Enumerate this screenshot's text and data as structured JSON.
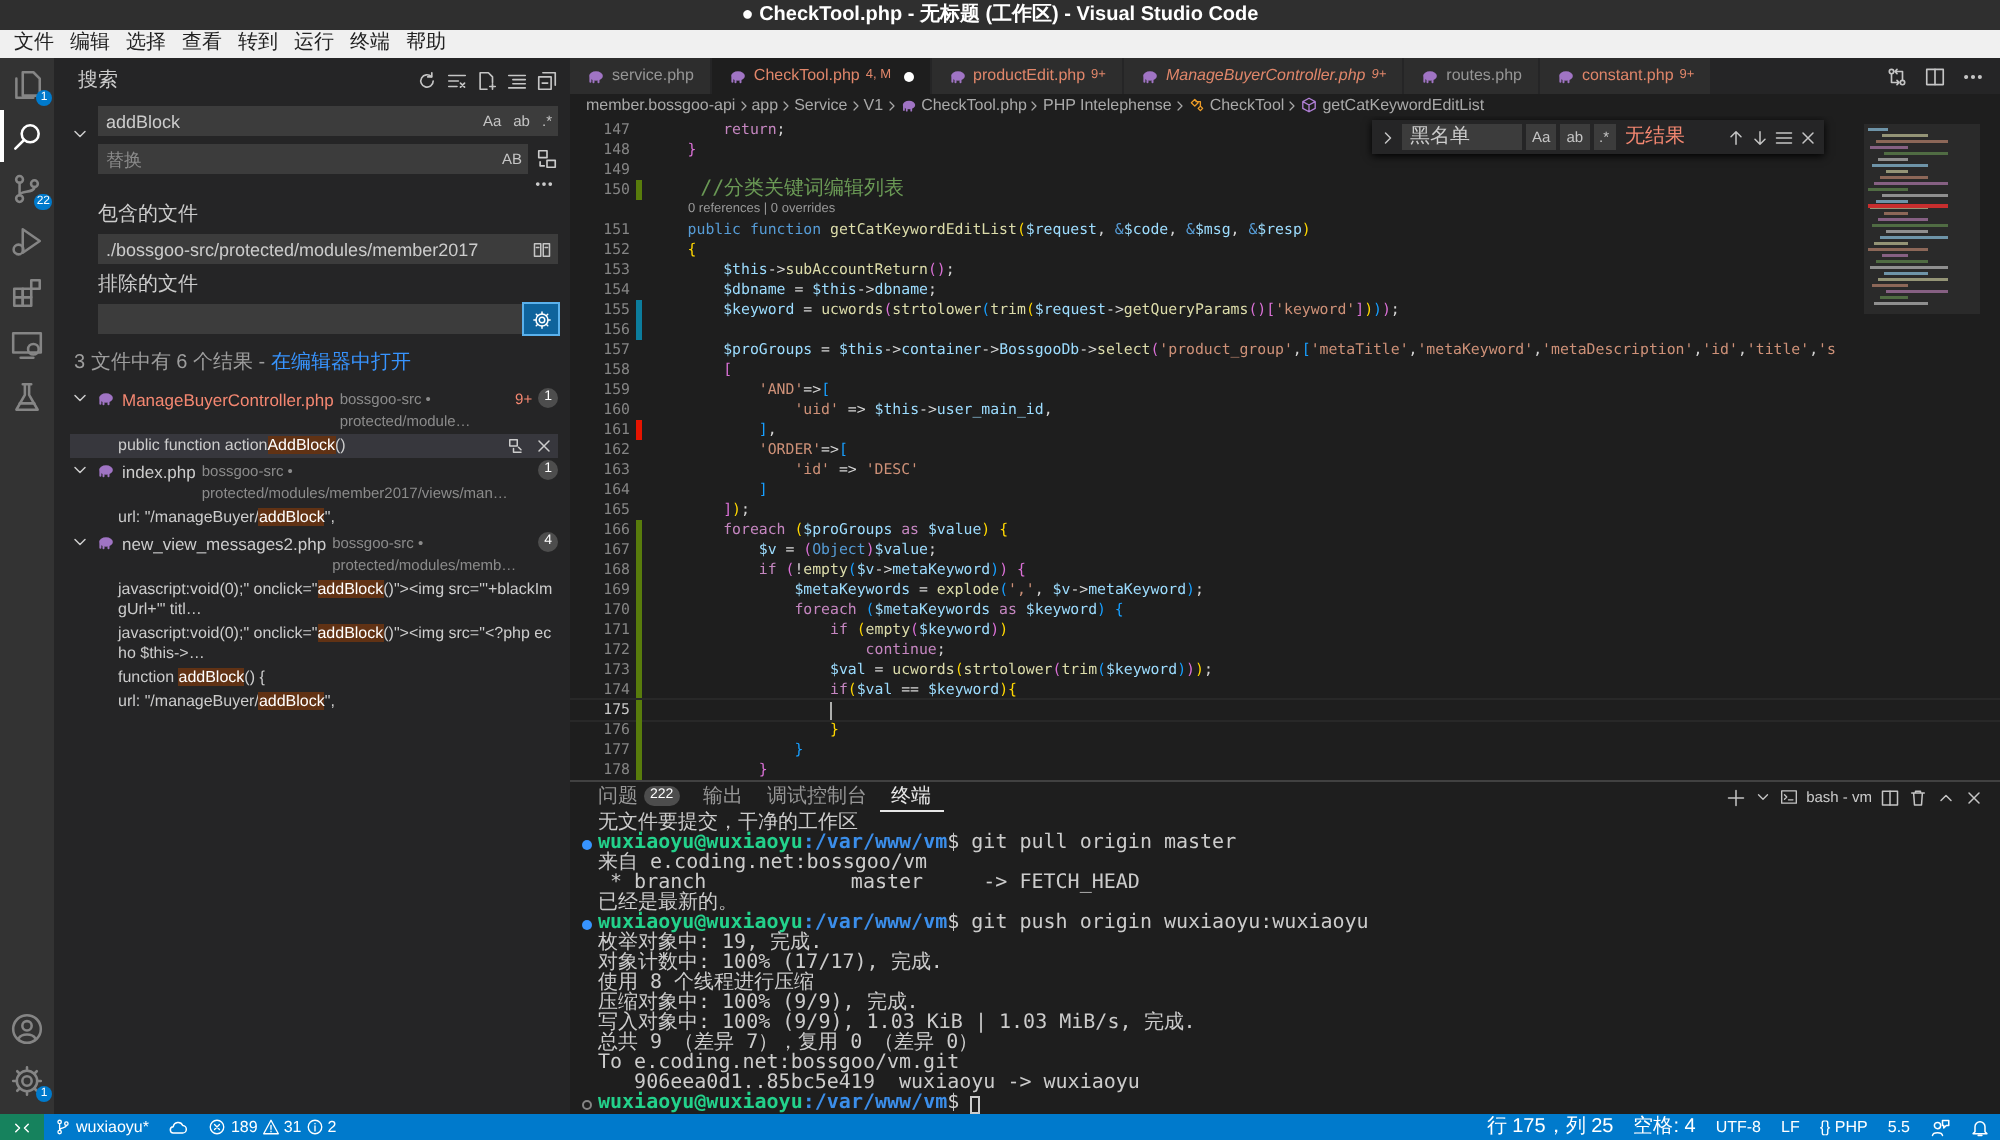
{
  "window": {
    "title": "● CheckTool.php - 无标题 (工作区) - Visual Studio Code"
  },
  "menu": [
    "文件",
    "编辑",
    "选择",
    "查看",
    "转到",
    "运行",
    "终端",
    "帮助"
  ],
  "activity_bar": {
    "top": [
      {
        "kind": "explorer",
        "selected": false,
        "badge": "1"
      },
      {
        "kind": "search",
        "selected": true
      },
      {
        "kind": "source_control",
        "selected": false,
        "badge": "22"
      },
      {
        "kind": "run",
        "selected": false
      },
      {
        "kind": "extensions",
        "selected": false
      },
      {
        "kind": "remote",
        "selected": false
      },
      {
        "kind": "testing",
        "selected": false
      }
    ],
    "bottom": [
      {
        "kind": "account",
        "selected": false
      },
      {
        "kind": "settings",
        "selected": false,
        "badge": "1"
      }
    ]
  },
  "search": {
    "title": "搜索",
    "query": "addBlock",
    "toggles": [
      {
        "label": "Aa",
        "on": false
      },
      {
        "label": "ab",
        "on": false
      },
      {
        "label": ".*",
        "on": false
      }
    ],
    "replace": {
      "placeholder": "替换",
      "toggle": {
        "label": "AB",
        "on": false
      }
    },
    "include_label": "包含的文件",
    "include": "./bossgoo-src/protected/modules/member2017",
    "exclude_label": "排除的文件",
    "use_exclude_settings": true,
    "summary": "3 文件中有 6 个结果 - ",
    "summary_link": "在编辑器中打开",
    "results": [
      {
        "name": "ManageBuyerController.php",
        "path": "bossgoo-src • protected/module…",
        "problems": "9+",
        "count": "1",
        "expanded": true,
        "matches": [
          {
            "before": "public function action",
            "match": "AddBlock",
            "after": "()",
            "selected": true
          }
        ]
      },
      {
        "name": "index.php",
        "path": "bossgoo-src • protected/modules/member2017/views/man…",
        "count": "1",
        "expanded": true,
        "matches": [
          {
            "before": "url: \"/manageBuyer/",
            "match": "addBlock",
            "after": "\",",
            "selected": false
          }
        ]
      },
      {
        "name": "new_view_messages2.php",
        "path": "bossgoo-src • protected/modules/memb…",
        "count": "4",
        "expanded": true,
        "matches": [
          {
            "before": "javascript:void(0);\" onclick=\"",
            "match": "addBlock",
            "after": "()\"><img src=\"'+blackImgUrl+'\" titl…",
            "selected": false
          },
          {
            "before": "javascript:void(0);\" onclick=\"",
            "match": "addBlock",
            "after": "()\"><img src=\"<?php echo $this->…",
            "selected": false
          },
          {
            "before": "function ",
            "match": "addBlock",
            "after": "() {",
            "selected": false
          },
          {
            "before": "url: \"/manageBuyer/",
            "match": "addBlock",
            "after": "\",",
            "selected": false
          }
        ]
      }
    ]
  },
  "tabs": [
    {
      "name": "service.php",
      "selected": false,
      "preview": false,
      "dirty": false
    },
    {
      "name": "CheckTool.php",
      "decoration": "4, M",
      "selected": true,
      "preview": false,
      "dirty": true
    },
    {
      "name": "productEdit.php",
      "decoration": "9+",
      "selected": false,
      "preview": false,
      "dirty": false
    },
    {
      "name": "ManageBuyerController.php",
      "decoration": "9+",
      "selected": false,
      "preview": true,
      "dirty": false
    },
    {
      "name": "routes.php",
      "selected": false,
      "preview": false,
      "dirty": false
    },
    {
      "name": "constant.php",
      "decoration": "9+",
      "selected": false,
      "preview": false,
      "dirty": false
    }
  ],
  "breadcrumb": [
    {
      "kind": "folder",
      "text": "member.bossgoo-api"
    },
    {
      "kind": "folder",
      "text": "app"
    },
    {
      "kind": "folder",
      "text": "Service"
    },
    {
      "kind": "folder",
      "text": "V1"
    },
    {
      "kind": "file",
      "text": "CheckTool.php"
    },
    {
      "kind": "folder",
      "text": "PHP Intelephense"
    },
    {
      "kind": "class",
      "text": "CheckTool"
    },
    {
      "kind": "method",
      "text": "getCatKeywordEditList"
    }
  ],
  "find": {
    "value": "黑名单",
    "toggles": [
      {
        "label": "Aa",
        "on": false
      },
      {
        "label": "ab",
        "on": false
      },
      {
        "label": ".*",
        "on": false
      }
    ],
    "result": "无结果"
  },
  "lines": [
    {
      "kind": "code",
      "number": "147",
      "current": false,
      "tokens": [
        {
          "kind": "k",
          "text": "        return"
        },
        {
          "kind": "p",
          "text": ";"
        }
      ]
    },
    {
      "kind": "code",
      "number": "148",
      "current": false,
      "tokens": [
        {
          "kind": "b2",
          "text": "    }"
        }
      ]
    },
    {
      "kind": "code",
      "number": "149",
      "current": false
    },
    {
      "kind": "code",
      "number": "150",
      "current": false,
      "color": "#587c0c",
      "tokens": [
        {
          "kind": "c",
          "text": "    //分类关键词编辑列表"
        }
      ]
    },
    {
      "kind": "codelens",
      "text": "0 references | 0 overrides"
    },
    {
      "kind": "code",
      "number": "151",
      "current": false,
      "tokens": [
        {
          "kind": "s",
          "text": "    public function "
        },
        {
          "kind": "f",
          "text": "getCatKeywordEditList"
        },
        {
          "kind": "b1",
          "text": "("
        },
        {
          "kind": "v",
          "text": "$request"
        },
        {
          "kind": "p",
          "text": ", "
        },
        {
          "kind": "s",
          "text": "&"
        },
        {
          "kind": "v",
          "text": "$code"
        },
        {
          "kind": "p",
          "text": ", "
        },
        {
          "kind": "s",
          "text": "&"
        },
        {
          "kind": "v",
          "text": "$msg"
        },
        {
          "kind": "p",
          "text": ", "
        },
        {
          "kind": "s",
          "text": "&"
        },
        {
          "kind": "v",
          "text": "$resp"
        },
        {
          "kind": "b1",
          "text": ")"
        }
      ]
    },
    {
      "kind": "code",
      "number": "152",
      "current": false,
      "tokens": [
        {
          "kind": "b1",
          "text": "    {"
        }
      ]
    },
    {
      "kind": "code",
      "number": "153",
      "current": false,
      "tokens": [
        {
          "kind": "v",
          "text": "        $this"
        },
        {
          "kind": "p",
          "text": "->"
        },
        {
          "kind": "f",
          "text": "subAccountReturn"
        },
        {
          "kind": "b2",
          "text": "()"
        },
        {
          "kind": "p",
          "text": ";"
        }
      ]
    },
    {
      "kind": "code",
      "number": "154",
      "current": false,
      "tokens": [
        {
          "kind": "v",
          "text": "        $dbname"
        },
        {
          "kind": "p",
          "text": " = "
        },
        {
          "kind": "v",
          "text": "$this"
        },
        {
          "kind": "p",
          "text": "->"
        },
        {
          "kind": "v",
          "text": "dbname"
        },
        {
          "kind": "p",
          "text": ";"
        }
      ]
    },
    {
      "kind": "code",
      "number": "155",
      "current": false,
      "color": "#0c7d9d",
      "tokens": [
        {
          "kind": "v",
          "text": "        $keyword"
        },
        {
          "kind": "p",
          "text": " = "
        },
        {
          "kind": "f",
          "text": "ucwords"
        },
        {
          "kind": "b2",
          "text": "("
        },
        {
          "kind": "f",
          "text": "strtolower"
        },
        {
          "kind": "b3",
          "text": "("
        },
        {
          "kind": "f",
          "text": "trim"
        },
        {
          "kind": "b1",
          "text": "("
        },
        {
          "kind": "v",
          "text": "$request"
        },
        {
          "kind": "p",
          "text": "->"
        },
        {
          "kind": "f",
          "text": "getQueryParams"
        },
        {
          "kind": "b2",
          "text": "()"
        },
        {
          "kind": "b2",
          "text": "["
        },
        {
          "kind": "t",
          "text": "'keyword'"
        },
        {
          "kind": "b2",
          "text": "]"
        },
        {
          "kind": "b1",
          "text": ")"
        },
        {
          "kind": "b3",
          "text": ")"
        },
        {
          "kind": "b2",
          "text": ")"
        },
        {
          "kind": "p",
          "text": ";"
        }
      ]
    },
    {
      "kind": "code",
      "number": "156",
      "current": false,
      "color": "#0c7d9d"
    },
    {
      "kind": "code",
      "number": "157",
      "current": false,
      "tokens": [
        {
          "kind": "v",
          "text": "        $proGroups"
        },
        {
          "kind": "p",
          "text": " = "
        },
        {
          "kind": "v",
          "text": "$this"
        },
        {
          "kind": "p",
          "text": "->"
        },
        {
          "kind": "v",
          "text": "container"
        },
        {
          "kind": "p",
          "text": "->"
        },
        {
          "kind": "v",
          "text": "BossgooDb"
        },
        {
          "kind": "p",
          "text": "->"
        },
        {
          "kind": "f",
          "text": "select"
        },
        {
          "kind": "b2",
          "text": "("
        },
        {
          "kind": "t",
          "text": "'product_group'"
        },
        {
          "kind": "p",
          "text": ","
        },
        {
          "kind": "b3",
          "text": "["
        },
        {
          "kind": "t",
          "text": "'metaTitle'"
        },
        {
          "kind": "p",
          "text": ","
        },
        {
          "kind": "t",
          "text": "'metaKeyword'"
        },
        {
          "kind": "p",
          "text": ","
        },
        {
          "kind": "t",
          "text": "'metaDescription'"
        },
        {
          "kind": "p",
          "text": ","
        },
        {
          "kind": "t",
          "text": "'id'"
        },
        {
          "kind": "p",
          "text": ","
        },
        {
          "kind": "t",
          "text": "'title'"
        },
        {
          "kind": "p",
          "text": ","
        },
        {
          "kind": "t",
          "text": "'s"
        }
      ]
    },
    {
      "kind": "code",
      "number": "158",
      "current": false,
      "tokens": [
        {
          "kind": "b2",
          "text": "        ["
        }
      ]
    },
    {
      "kind": "code",
      "number": "159",
      "current": false,
      "tokens": [
        {
          "kind": "t",
          "text": "            'AND'"
        },
        {
          "kind": "p",
          "text": "=>"
        },
        {
          "kind": "b3",
          "text": "["
        }
      ]
    },
    {
      "kind": "code",
      "number": "160",
      "current": false,
      "tokens": [
        {
          "kind": "t",
          "text": "                'uid'"
        },
        {
          "kind": "p",
          "text": " => "
        },
        {
          "kind": "v",
          "text": "$this"
        },
        {
          "kind": "p",
          "text": "->"
        },
        {
          "kind": "v",
          "text": "user_main_id"
        },
        {
          "kind": "p",
          "text": ","
        }
      ]
    },
    {
      "kind": "code",
      "number": "161",
      "current": false,
      "color": "#e51400",
      "tokens": [
        {
          "kind": "b3",
          "text": "            ]"
        },
        {
          "kind": "p",
          "text": ","
        }
      ]
    },
    {
      "kind": "code",
      "number": "162",
      "current": false,
      "tokens": [
        {
          "kind": "t",
          "text": "            'ORDER'"
        },
        {
          "kind": "p",
          "text": "=>"
        },
        {
          "kind": "b3",
          "text": "["
        }
      ]
    },
    {
      "kind": "code",
      "number": "163",
      "current": false,
      "tokens": [
        {
          "kind": "t",
          "text": "                'id'"
        },
        {
          "kind": "p",
          "text": " => "
        },
        {
          "kind": "t",
          "text": "'DESC'"
        }
      ]
    },
    {
      "kind": "code",
      "number": "164",
      "current": false,
      "tokens": [
        {
          "kind": "b3",
          "text": "            ]"
        }
      ]
    },
    {
      "kind": "code",
      "number": "165",
      "current": false,
      "tokens": [
        {
          "kind": "b2",
          "text": "        ]"
        },
        {
          "kind": "b1",
          "text": ")"
        },
        {
          "kind": "p",
          "text": ";"
        }
      ]
    },
    {
      "kind": "code",
      "number": "166",
      "current": false,
      "color": "#587c0c",
      "tokens": [
        {
          "kind": "k",
          "text": "        foreach "
        },
        {
          "kind": "b1",
          "text": "("
        },
        {
          "kind": "v",
          "text": "$proGroups"
        },
        {
          "kind": "k",
          "text": " as "
        },
        {
          "kind": "v",
          "text": "$value"
        },
        {
          "kind": "b1",
          "text": ") {"
        }
      ]
    },
    {
      "kind": "code",
      "number": "167",
      "current": false,
      "color": "#587c0c",
      "tokens": [
        {
          "kind": "v",
          "text": "            $v"
        },
        {
          "kind": "p",
          "text": " = "
        },
        {
          "kind": "b2",
          "text": "("
        },
        {
          "kind": "s",
          "text": "Object"
        },
        {
          "kind": "b2",
          "text": ")"
        },
        {
          "kind": "v",
          "text": "$value"
        },
        {
          "kind": "p",
          "text": ";"
        }
      ]
    },
    {
      "kind": "code",
      "number": "168",
      "current": false,
      "color": "#587c0c",
      "tokens": [
        {
          "kind": "k",
          "text": "            if "
        },
        {
          "kind": "b2",
          "text": "("
        },
        {
          "kind": "p",
          "text": "!"
        },
        {
          "kind": "f",
          "text": "empty"
        },
        {
          "kind": "b3",
          "text": "("
        },
        {
          "kind": "v",
          "text": "$v"
        },
        {
          "kind": "p",
          "text": "->"
        },
        {
          "kind": "v",
          "text": "metaKeyword"
        },
        {
          "kind": "b3",
          "text": ")"
        },
        {
          "kind": "b2",
          "text": ") {"
        }
      ]
    },
    {
      "kind": "code",
      "number": "169",
      "current": false,
      "color": "#587c0c",
      "tokens": [
        {
          "kind": "v",
          "text": "                $metaKeywords"
        },
        {
          "kind": "p",
          "text": " = "
        },
        {
          "kind": "f",
          "text": "explode"
        },
        {
          "kind": "b3",
          "text": "("
        },
        {
          "kind": "t",
          "text": "','"
        },
        {
          "kind": "p",
          "text": ", "
        },
        {
          "kind": "v",
          "text": "$v"
        },
        {
          "kind": "p",
          "text": "->"
        },
        {
          "kind": "v",
          "text": "metaKeyword"
        },
        {
          "kind": "b3",
          "text": ")"
        },
        {
          "kind": "p",
          "text": ";"
        }
      ]
    },
    {
      "kind": "code",
      "number": "170",
      "current": false,
      "color": "#587c0c",
      "tokens": [
        {
          "kind": "k",
          "text": "                foreach "
        },
        {
          "kind": "b3",
          "text": "("
        },
        {
          "kind": "v",
          "text": "$metaKeywords"
        },
        {
          "kind": "k",
          "text": " as "
        },
        {
          "kind": "v",
          "text": "$keyword"
        },
        {
          "kind": "b3",
          "text": ") {"
        }
      ]
    },
    {
      "kind": "code",
      "number": "171",
      "current": false,
      "color": "#587c0c",
      "tokens": [
        {
          "kind": "k",
          "text": "                    if "
        },
        {
          "kind": "b1",
          "text": "("
        },
        {
          "kind": "f",
          "text": "empty"
        },
        {
          "kind": "b2",
          "text": "("
        },
        {
          "kind": "v",
          "text": "$keyword"
        },
        {
          "kind": "b2",
          "text": ")"
        },
        {
          "kind": "b1",
          "text": ")"
        }
      ]
    },
    {
      "kind": "code",
      "number": "172",
      "current": false,
      "color": "#587c0c",
      "tokens": [
        {
          "kind": "k",
          "text": "                        continue"
        },
        {
          "kind": "p",
          "text": ";"
        }
      ]
    },
    {
      "kind": "code",
      "number": "173",
      "current": false,
      "color": "#587c0c",
      "tokens": [
        {
          "kind": "v",
          "text": "                    $val"
        },
        {
          "kind": "p",
          "text": " = "
        },
        {
          "kind": "f",
          "text": "ucwords"
        },
        {
          "kind": "b1",
          "text": "("
        },
        {
          "kind": "f",
          "text": "strtolower"
        },
        {
          "kind": "b2",
          "text": "("
        },
        {
          "kind": "f",
          "text": "trim"
        },
        {
          "kind": "b3",
          "text": "("
        },
        {
          "kind": "v",
          "text": "$keyword"
        },
        {
          "kind": "b3",
          "text": ")"
        },
        {
          "kind": "b2",
          "text": ")"
        },
        {
          "kind": "b1",
          "text": ")"
        },
        {
          "kind": "p",
          "text": ";"
        }
      ]
    },
    {
      "kind": "code",
      "number": "174",
      "current": false,
      "color": "#587c0c",
      "tokens": [
        {
          "kind": "k",
          "text": "                    if"
        },
        {
          "kind": "b1",
          "text": "("
        },
        {
          "kind": "v",
          "text": "$val"
        },
        {
          "kind": "p",
          "text": " == "
        },
        {
          "kind": "v",
          "text": "$keyword"
        },
        {
          "kind": "b1",
          "text": ")"
        },
        {
          "kind": "b1",
          "text": "{"
        }
      ]
    },
    {
      "kind": "code",
      "number": "175",
      "current": true,
      "color": "#587c0c"
    },
    {
      "kind": "code",
      "number": "176",
      "current": false,
      "color": "#587c0c",
      "tokens": [
        {
          "kind": "b1",
          "text": "                    }"
        }
      ]
    },
    {
      "kind": "code",
      "number": "177",
      "current": false,
      "color": "#587c0c",
      "tokens": [
        {
          "kind": "b3",
          "text": "                }"
        }
      ]
    },
    {
      "kind": "code",
      "number": "178",
      "current": false,
      "color": "#587c0c",
      "tokens": [
        {
          "kind": "b2",
          "text": "            }"
        }
      ]
    }
  ],
  "panel": {
    "tabs": [
      {
        "label": "问题",
        "count": "222",
        "selected": false
      },
      {
        "label": "输出",
        "selected": false
      },
      {
        "label": "调试控制台",
        "selected": false
      },
      {
        "label": "终端",
        "selected": true
      }
    ],
    "terminal_name": "bash - vm",
    "lines": [
      {
        "kind": "output",
        "text": "无文件要提交，干净的工作区"
      },
      {
        "kind": "prompt",
        "done": true,
        "user": "wuxiaoyu@wuxiaoyu",
        "path": ":/var/www/vm",
        "command": "$ git pull origin master"
      },
      {
        "kind": "output",
        "text": "来自 e.coding.net:bossgoo/vm"
      },
      {
        "kind": "output",
        "text": " * branch            master     -> FETCH_HEAD"
      },
      {
        "kind": "output",
        "text": "已经是最新的。"
      },
      {
        "kind": "prompt",
        "done": true,
        "user": "wuxiaoyu@wuxiaoyu",
        "path": ":/var/www/vm",
        "command": "$ git push origin wuxiaoyu:wuxiaoyu"
      },
      {
        "kind": "output",
        "text": "枚举对象中: 19, 完成."
      },
      {
        "kind": "output",
        "text": "对象计数中: 100% (17/17), 完成."
      },
      {
        "kind": "output",
        "text": "使用 8 个线程进行压缩"
      },
      {
        "kind": "output",
        "text": "压缩对象中: 100% (9/9), 完成."
      },
      {
        "kind": "output",
        "text": "写入对象中: 100% (9/9), 1.03 KiB | 1.03 MiB/s, 完成."
      },
      {
        "kind": "output",
        "text": "总共 9 （差异 7），复用 0 （差异 0）"
      },
      {
        "kind": "output",
        "text": "To e.coding.net:bossgoo/vm.git"
      },
      {
        "kind": "output",
        "text": "   906eea0d1..85bc5e419  wuxiaoyu -> wuxiaoyu"
      },
      {
        "kind": "prompt",
        "done": false,
        "user": "wuxiaoyu@wuxiaoyu",
        "path": ":/var/www/vm",
        "command": "$"
      }
    ]
  },
  "status_bar": {
    "branch": "wuxiaoyu*",
    "errors": "189",
    "warnings": "31",
    "infos": "2",
    "position": "行 175，列 25",
    "indent": "空格: 4",
    "encoding": "UTF-8",
    "eol": "LF",
    "language": "{} PHP",
    "version": "5.5"
  }
}
